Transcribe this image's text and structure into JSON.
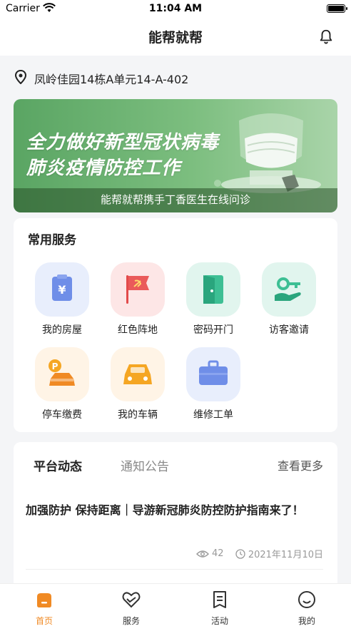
{
  "status_bar": {
    "carrier": "Carrier",
    "time": "11:04 AM"
  },
  "nav": {
    "title": "能帮就帮"
  },
  "address": {
    "text": "凤岭佳园14栋A单元14-A-402"
  },
  "banner": {
    "line1": "全力做好新型冠状病毒",
    "line2": "肺炎疫情防控工作",
    "caption": "能帮就帮携手丁香医生在线问诊"
  },
  "services": {
    "heading": "常用服务",
    "items": [
      {
        "label": "我的房屋",
        "icon": "house-bill-icon"
      },
      {
        "label": "红色阵地",
        "icon": "red-flag-icon"
      },
      {
        "label": "密码开门",
        "icon": "door-icon"
      },
      {
        "label": "访客邀请",
        "icon": "key-hand-icon"
      },
      {
        "label": "停车缴费",
        "icon": "parking-car-icon"
      },
      {
        "label": "我的车辆",
        "icon": "car-icon"
      },
      {
        "label": "维修工单",
        "icon": "toolbox-icon"
      }
    ]
  },
  "news": {
    "tab_active": "平台动态",
    "tab_other": "通知公告",
    "more": "查看更多",
    "article": {
      "title": "加强防护 保持距离｜导游新冠肺炎防控防护指南来了！",
      "views": "42",
      "date": "2021年11月10日"
    }
  },
  "tabbar": {
    "items": [
      {
        "label": "首页",
        "active": true
      },
      {
        "label": "服务",
        "active": false
      },
      {
        "label": "活动",
        "active": false
      },
      {
        "label": "我的",
        "active": false
      }
    ]
  },
  "colors": {
    "accent": "#f08a24",
    "banner_green": "#6bb36f"
  }
}
